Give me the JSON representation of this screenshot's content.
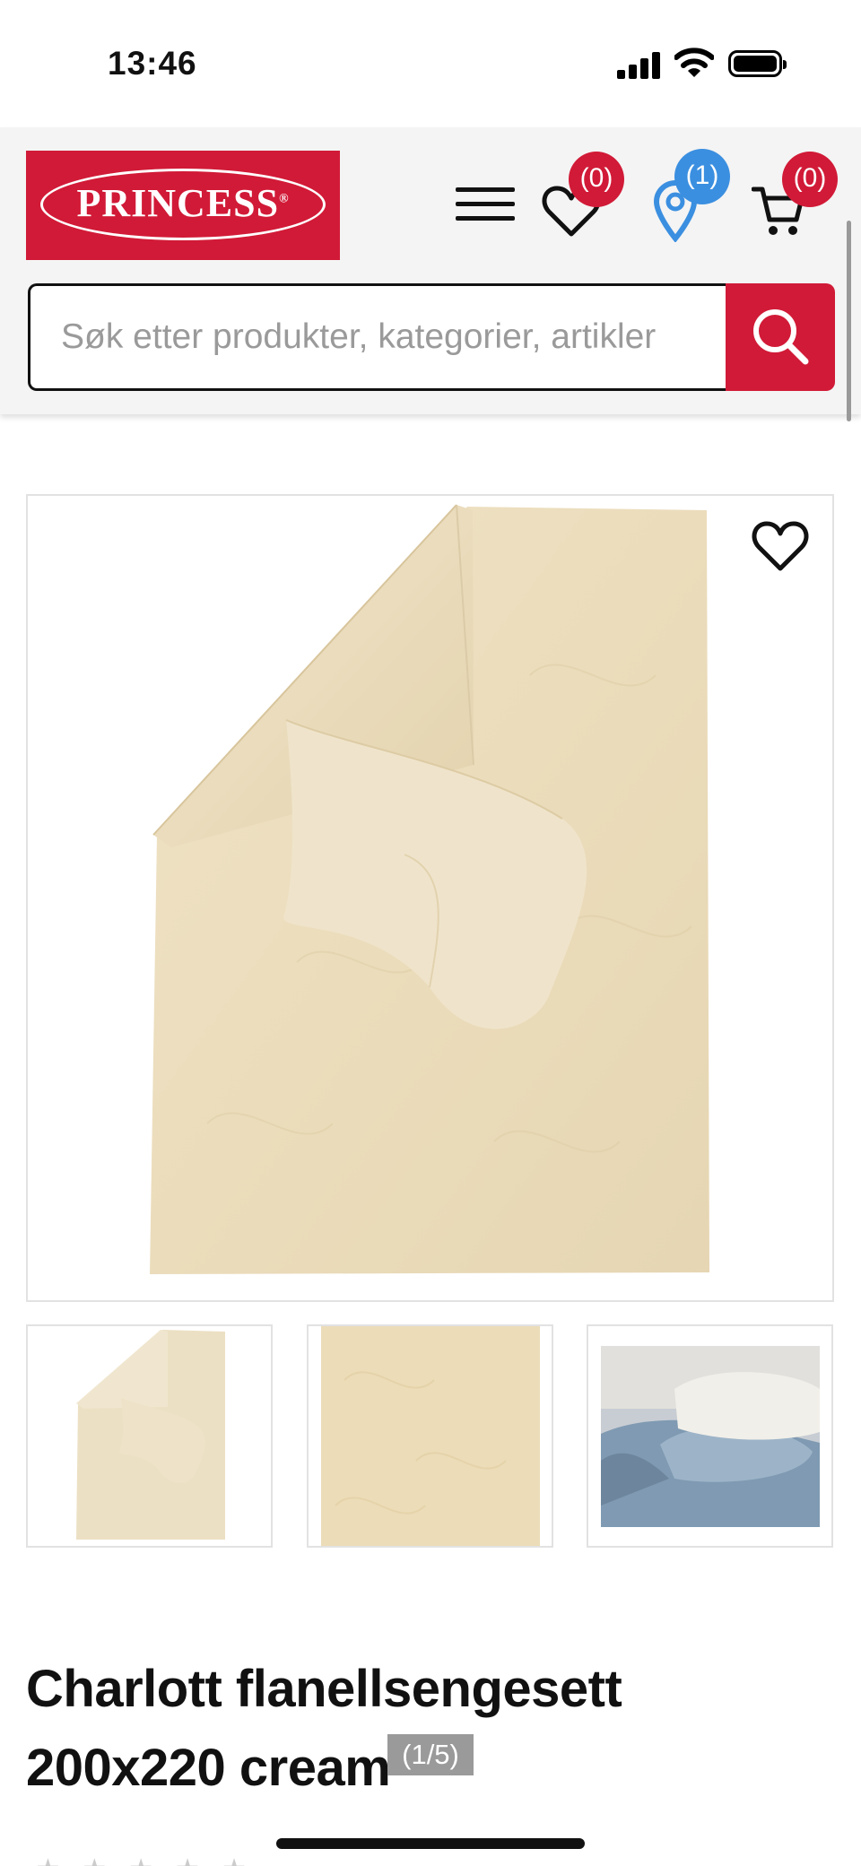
{
  "status_bar": {
    "time": "13:46"
  },
  "header": {
    "logo_text": "PRINCESS",
    "logo_reg": "®",
    "favorites_count": "(0)",
    "location_count": "(1)",
    "cart_count": "(0)",
    "brand_color": "#d11a37",
    "location_badge_color": "#3b8fe0"
  },
  "search": {
    "placeholder": "Søk etter produkter, kategorier, artikler",
    "icon": "search-icon"
  },
  "product": {
    "title": "Charlott flanellsengesett 200x220 cream",
    "image_counter": "(1/5)"
  }
}
